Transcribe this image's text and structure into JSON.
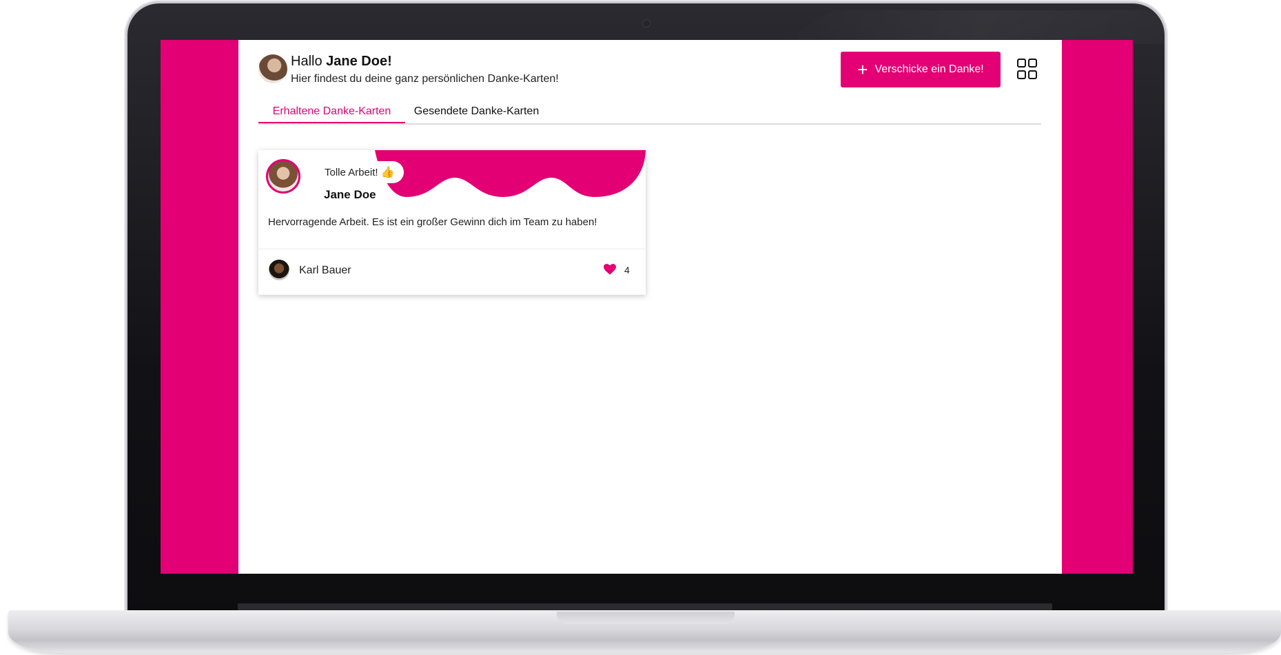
{
  "header": {
    "greeting_prefix": "Hallo",
    "user_name": "Jane Doe!",
    "subtitle": "Hier findest du deine ganz persönlichen Danke-Karten!",
    "send_button_label": "Verschicke ein Danke!"
  },
  "tabs": [
    {
      "label": "Erhaltene Danke-Karten",
      "active": true
    },
    {
      "label": "Gesendete Danke-Karten",
      "active": false
    }
  ],
  "cards": [
    {
      "badge": "Tolle Arbeit!",
      "badge_icon": "thumbs-up-icon",
      "recipient": "Jane Doe",
      "message": "Hervorragende Arbeit. Es ist ein großer Gewinn dich im Team zu haben!",
      "sender": "Karl Bauer",
      "likes": "4"
    }
  ],
  "colors": {
    "brand_magenta": "#e20074",
    "text": "#111111"
  }
}
